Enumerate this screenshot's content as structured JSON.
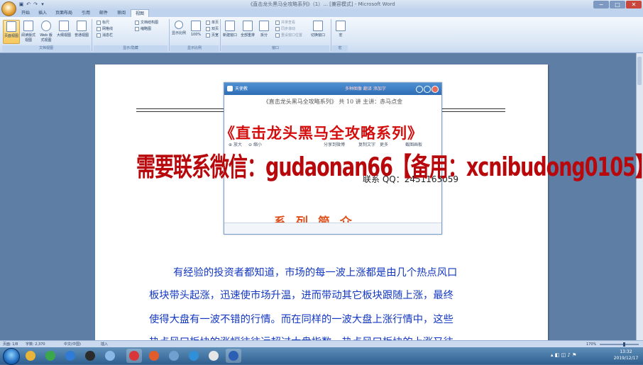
{
  "window": {
    "title": "《直击龙头黑马全攻略系列》（1）... [兼容模式] - Microsoft Word",
    "controls": {
      "minimize": "−",
      "maximize": "□",
      "close": "✕"
    }
  },
  "quick_access": {
    "save": "▣",
    "undo": "↶",
    "redo": "↷",
    "more": "▾"
  },
  "tabs": [
    "开始",
    "插入",
    "页面布局",
    "引用",
    "邮件",
    "审阅",
    "视图"
  ],
  "active_tab": "视图",
  "ribbon": {
    "doc_views": [
      "页面视图",
      "阅读版式视图",
      "Web 版式视图",
      "大纲视图",
      "普通视图"
    ],
    "show_hide": [
      "标尺",
      "网格线",
      "消息栏",
      "文档结构图",
      "缩略图"
    ],
    "zoom": {
      "zoom": "显示比例",
      "pct100": "100%",
      "one_page": "单页",
      "two_pages": "双页",
      "page_width": "页宽"
    },
    "window": {
      "new_window": "新建窗口",
      "arrange_all": "全部重排",
      "split": "拆分",
      "side_by_side": "并排查看",
      "sync_scroll": "同步滚动",
      "reset_position": "重设窗口位置",
      "switch_windows": "切换窗口"
    },
    "macros": "宏",
    "groups": [
      "文档视图",
      "显示/隐藏",
      "显示比例",
      "窗口",
      "宏"
    ]
  },
  "reader": {
    "title": "天使教",
    "header_links": "多种图像 翻译 添加字",
    "doc_header": "《直击龙头黑马全攻略系列》 共 10 讲   主讲：赤马点金",
    "contact_qq": "联系 QQ：2451163059",
    "series_heading": "系 列 简 介",
    "toolbar": [
      "放大",
      "缩小",
      "分享到微博",
      "复制文字",
      "更多",
      "截图画板"
    ]
  },
  "watermark": {
    "title": "《直击龙头黑马全攻略系列》",
    "contact": "需要联系微信：gudaonan66【备用：xcnibudong0105】"
  },
  "body_text": [
    "有经验的投资者都知道，市场的每一波上涨都是由几个热点风口",
    "板块带头起涨，迅速使市场升温，进而带动其它板块跟随上涨，最终",
    "使得大盘有一波不错的行情。而在同样的一波大盘上涨行情中，这些",
    "热点风口板块的涨幅往往远超过大盘指数，热点风口板块的上涨又往"
  ],
  "status_bar": {
    "page": "页面: 1/8",
    "words": "字数: 2,370",
    "lang": "中文(中国)",
    "mode": "插入",
    "zoom": "170%"
  },
  "taskbar": {
    "clock_time": "13:32",
    "clock_date": "2019/12/17"
  },
  "colors": {
    "accent": "#2e6db4",
    "watermark_red": "#d40d0d",
    "body_blue": "#1338c2"
  }
}
